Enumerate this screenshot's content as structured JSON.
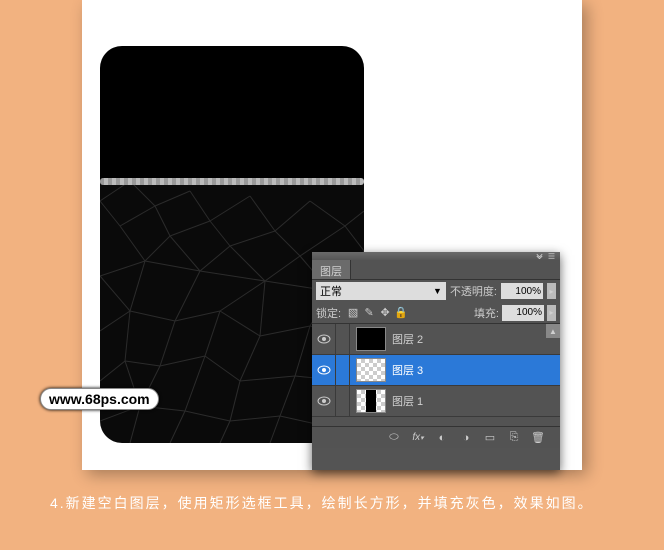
{
  "panel": {
    "tab": "图层",
    "blend_mode": "正常",
    "opacity_label": "不透明度:",
    "opacity_value": "100%",
    "lock_label": "锁定:",
    "fill_label": "填充:",
    "fill_value": "100%"
  },
  "layers": [
    {
      "name": "图层 2"
    },
    {
      "name": "图层 3"
    },
    {
      "name": "图层 1"
    }
  ],
  "watermark": "www.68ps.com",
  "caption": "4.新建空白图层，使用矩形选框工具，绘制长方形，并填充灰色，效果如图。"
}
